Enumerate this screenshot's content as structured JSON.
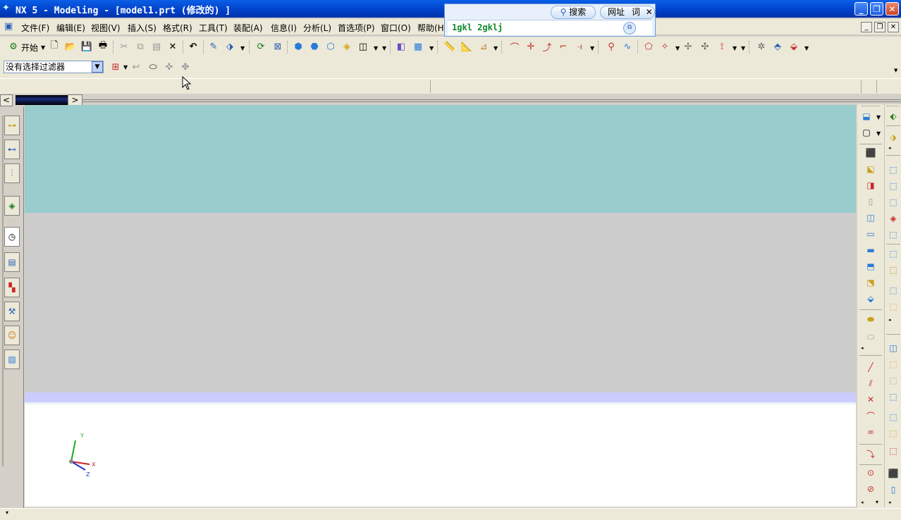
{
  "window": {
    "title": "NX 5 - Modeling - [model1.prt (修改的) ]"
  },
  "menu": {
    "items": [
      "文件(F)",
      "编辑(E)",
      "视图(V)",
      "插入(S)",
      "格式(R)",
      "工具(T)",
      "装配(A)",
      "信息(I)",
      "分析(L)",
      "首选项(P)",
      "窗口(O)",
      "帮助(H"
    ]
  },
  "toolbar": {
    "start_label": "开始"
  },
  "selection": {
    "filter_value": "没有选择过滤器"
  },
  "search_popup": {
    "search_tab": "搜索",
    "url_tab": "网址",
    "dict_tab": "词",
    "input_value": "1gkl 2gklj"
  },
  "triad": {
    "x_label": "X",
    "y_label": "Y",
    "z_label": "Z"
  },
  "tabstrip": {
    "left_arrow": "<",
    "right_arrow": ">"
  },
  "colors": {
    "viewport_top": "#99cccc",
    "viewport_mid": "#cccccc",
    "viewport_band": "#ccccff",
    "viewport_bottom": "#ffffff",
    "popup_text": "#0a8a2a"
  }
}
